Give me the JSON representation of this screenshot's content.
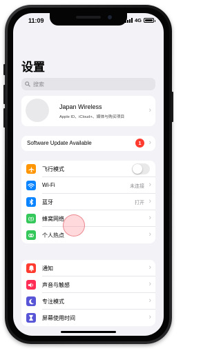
{
  "status_bar": {
    "time": "11:09",
    "network": "4G",
    "battery_level": 1.0
  },
  "title": "设置",
  "search": {
    "placeholder": "搜索"
  },
  "profile": {
    "name": "Japan Wireless",
    "subtitle": "Apple ID、iCloud+、媒体与购买项目"
  },
  "update": {
    "label": "Software Update Available",
    "badge": "1"
  },
  "connectivity": [
    {
      "icon": "airplane-icon",
      "color": "#ff9500",
      "label": "飞行模式",
      "toggle": false
    },
    {
      "icon": "wifi-icon",
      "color": "#0a84ff",
      "label": "Wi-Fi",
      "value": "未连接"
    },
    {
      "icon": "bluetooth-icon",
      "color": "#0a84ff",
      "label": "蓝牙",
      "value": "打开"
    },
    {
      "icon": "cellular-icon",
      "color": "#34c759",
      "label": "蜂窝网络"
    },
    {
      "icon": "hotspot-icon",
      "color": "#34c759",
      "label": "个人热点"
    }
  ],
  "general": [
    {
      "icon": "bell-icon",
      "color": "#ff3b30",
      "label": "通知"
    },
    {
      "icon": "speaker-icon",
      "color": "#ff2d55",
      "label": "声音与触感"
    },
    {
      "icon": "moon-icon",
      "color": "#5856d6",
      "label": "专注模式"
    },
    {
      "icon": "hourglass-icon",
      "color": "#5856d6",
      "label": "屏幕使用时间"
    }
  ]
}
